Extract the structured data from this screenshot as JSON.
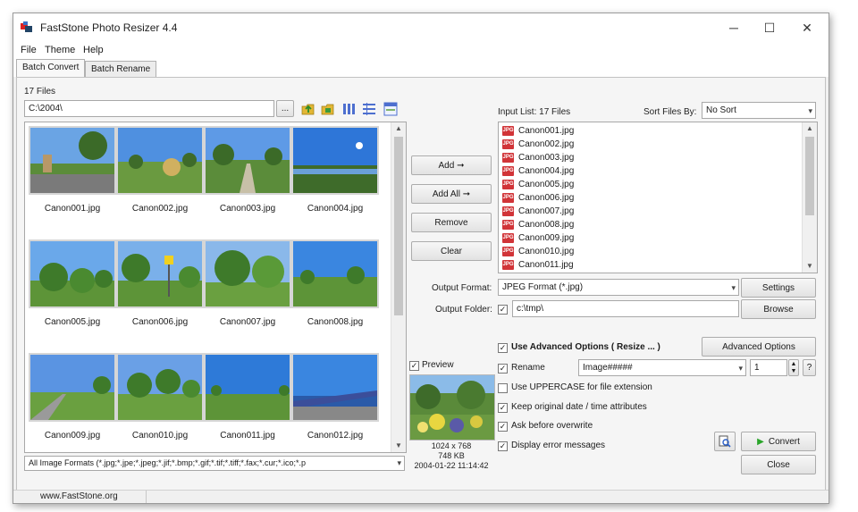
{
  "window": {
    "title": "FastStone Photo Resizer 4.4",
    "minimize": "─",
    "maximize": "☐",
    "close": "✕"
  },
  "menu": [
    "File",
    "Theme",
    "Help"
  ],
  "tabs": [
    "Batch Convert",
    "Batch Rename"
  ],
  "left": {
    "file_count": "17 Files",
    "path": "C:\\2004\\",
    "browse_button": "...",
    "thumbnails": [
      {
        "name": "Canon001.jpg",
        "scene": "street"
      },
      {
        "name": "Canon002.jpg",
        "scene": "park"
      },
      {
        "name": "Canon003.jpg",
        "scene": "path"
      },
      {
        "name": "Canon004.jpg",
        "scene": "sky"
      },
      {
        "name": "Canon005.jpg",
        "scene": "trees"
      },
      {
        "name": "Canon006.jpg",
        "scene": "sign"
      },
      {
        "name": "Canon007.jpg",
        "scene": "trees2"
      },
      {
        "name": "Canon008.jpg",
        "scene": "lake"
      },
      {
        "name": "Canon009.jpg",
        "scene": "road"
      },
      {
        "name": "Canon010.jpg",
        "scene": "trees3"
      },
      {
        "name": "Canon011.jpg",
        "scene": "field"
      },
      {
        "name": "Canon012.jpg",
        "scene": "bridge"
      }
    ],
    "format_filter": "All Image Formats (*.jpg;*.jpe;*.jpeg;*.jif;*.bmp;*.gif;*.tif;*.tiff;*.fax;*.cur;*.ico;*.p"
  },
  "middle": {
    "add": "Add ➞",
    "add_all": "Add All ➞",
    "remove": "Remove",
    "clear": "Clear",
    "preview_label": "Preview",
    "preview_checked": true,
    "image_dims": "1024 x 768",
    "image_size": "748 KB",
    "image_date": "2004-01-22 11:14:42"
  },
  "right": {
    "input_list_label": "Input List:  17 Files",
    "sort_label": "Sort Files By:",
    "sort_value": "No Sort",
    "input_files": [
      "Canon001.jpg",
      "Canon002.jpg",
      "Canon003.jpg",
      "Canon004.jpg",
      "Canon005.jpg",
      "Canon006.jpg",
      "Canon007.jpg",
      "Canon008.jpg",
      "Canon009.jpg",
      "Canon010.jpg",
      "Canon011.jpg"
    ],
    "file_icon_text": "JPG",
    "output_format_label": "Output Format:",
    "output_format_value": "JPEG Format (*.jpg)",
    "settings_button": "Settings",
    "output_folder_label": "Output Folder:",
    "output_folder_checked": true,
    "output_folder_value": "c:\\tmp\\",
    "browse_button": "Browse",
    "advanced_checked": true,
    "advanced_label": "Use Advanced Options ( Resize ... )",
    "advanced_button": "Advanced Options",
    "rename_checked": true,
    "rename_label": "Rename",
    "rename_value": "Image#####",
    "rename_start": "1",
    "help_button": "?",
    "uppercase_checked": false,
    "uppercase_label": "Use UPPERCASE for file extension",
    "keep_date_checked": true,
    "keep_date_label": "Keep original date / time attributes",
    "ask_overwrite_checked": true,
    "ask_overwrite_label": "Ask before overwrite",
    "display_errors_checked": true,
    "display_errors_label": "Display error messages",
    "convert_button": "Convert",
    "close_button": "Close"
  },
  "status": {
    "url": "www.FastStone.org"
  },
  "colors": {
    "convert_arrow": "#2aa52a",
    "file_icon": "#d13438"
  }
}
